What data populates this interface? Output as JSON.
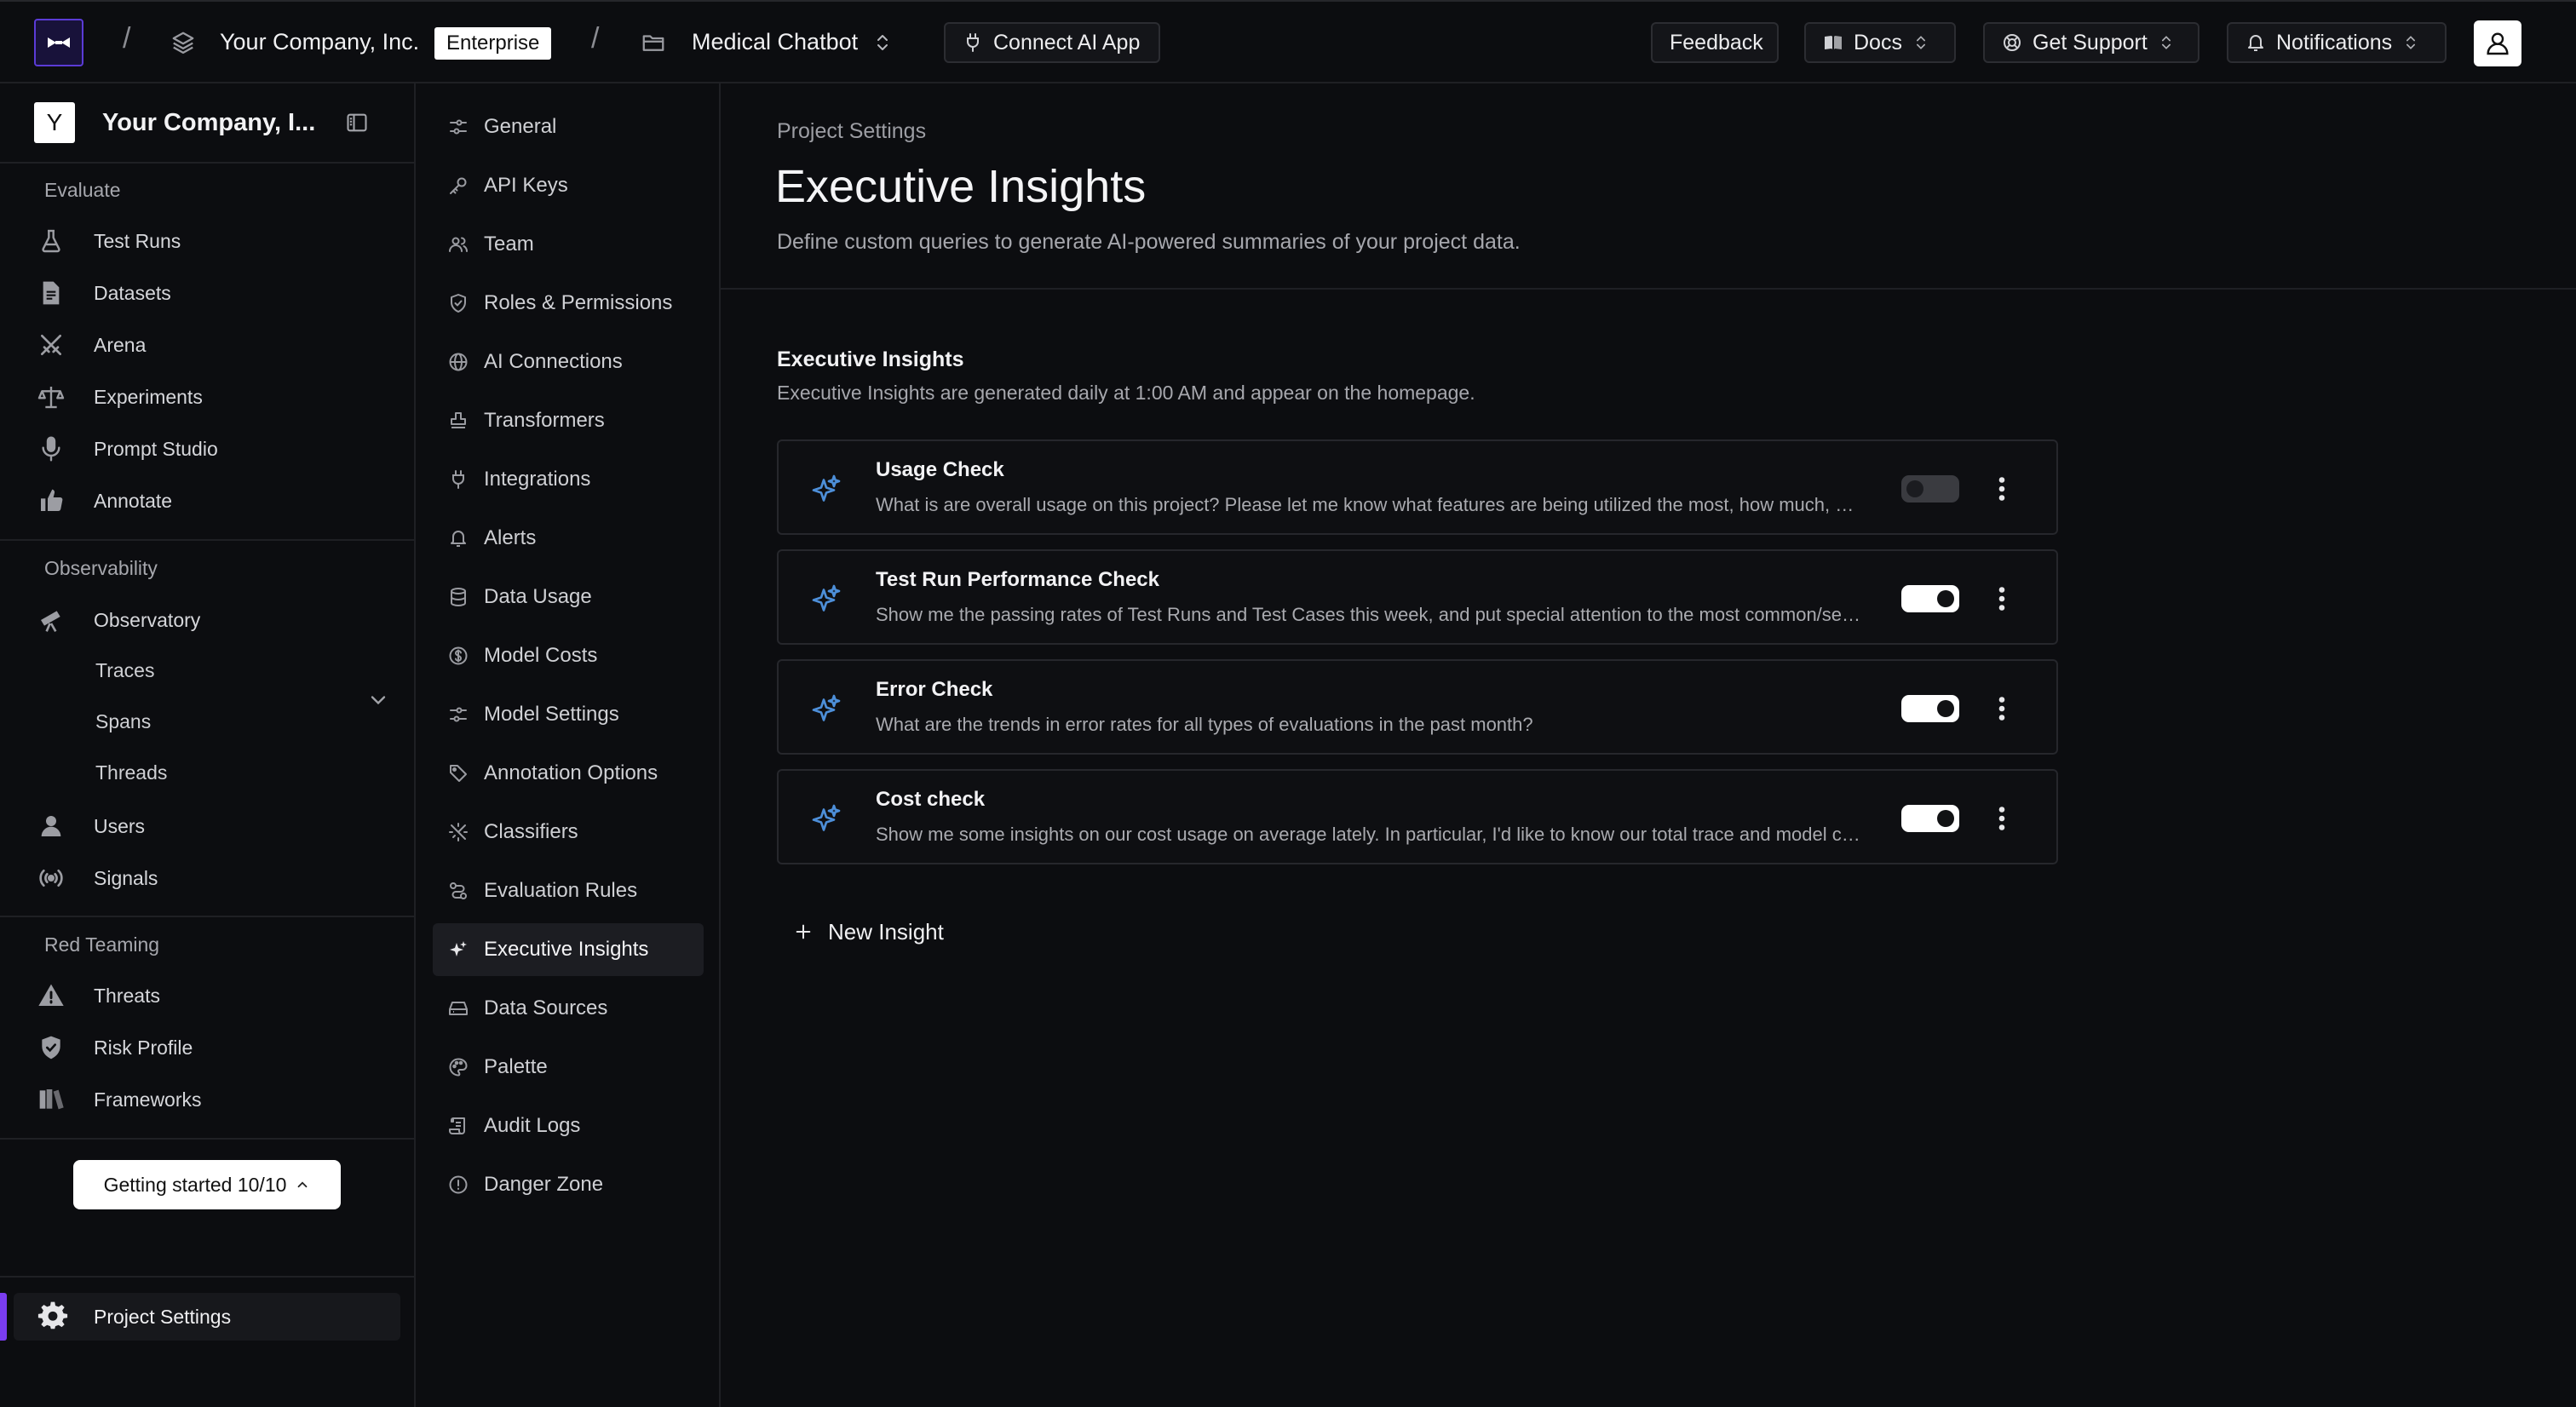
{
  "topbar": {
    "org_name": "Your Company, Inc.",
    "plan_badge": "Enterprise",
    "project_name": "Medical Chatbot",
    "connect_label": "Connect AI App",
    "feedback_label": "Feedback",
    "docs_label": "Docs",
    "support_label": "Get Support",
    "notifications_label": "Notifications",
    "separator": "/"
  },
  "sidebar": {
    "org_initial": "Y",
    "org_name": "Your Company, I...",
    "sections": [
      {
        "title": "Evaluate",
        "items": [
          {
            "label": "Test Runs",
            "icon": "flask-icon"
          },
          {
            "label": "Datasets",
            "icon": "document-icon"
          },
          {
            "label": "Arena",
            "icon": "swords-icon"
          },
          {
            "label": "Experiments",
            "icon": "scale-icon"
          },
          {
            "label": "Prompt Studio",
            "icon": "microphone-icon"
          },
          {
            "label": "Annotate",
            "icon": "thumbs-up-icon"
          }
        ]
      },
      {
        "title": "Observability",
        "items": [
          {
            "label": "Observatory",
            "icon": "telescope-icon"
          },
          {
            "label": "Traces"
          },
          {
            "label": "Spans"
          },
          {
            "label": "Threads"
          },
          {
            "label": "Users",
            "icon": "user-icon"
          },
          {
            "label": "Signals",
            "icon": "signal-icon"
          }
        ]
      },
      {
        "title": "Red Teaming",
        "items": [
          {
            "label": "Threats",
            "icon": "warning-icon"
          },
          {
            "label": "Risk Profile",
            "icon": "shield-icon"
          },
          {
            "label": "Frameworks",
            "icon": "book-icon"
          }
        ]
      }
    ],
    "getting_started": "Getting started 10/10",
    "project_settings": "Project Settings"
  },
  "settings_nav": {
    "active": "Executive Insights",
    "items": [
      {
        "label": "General",
        "icon": "sliders-icon"
      },
      {
        "label": "API Keys",
        "icon": "key-icon"
      },
      {
        "label": "Team",
        "icon": "users-icon"
      },
      {
        "label": "Roles & Permissions",
        "icon": "shield-check-icon"
      },
      {
        "label": "AI Connections",
        "icon": "globe-icon"
      },
      {
        "label": "Transformers",
        "icon": "stamp-icon"
      },
      {
        "label": "Integrations",
        "icon": "plug-icon"
      },
      {
        "label": "Alerts",
        "icon": "bell-icon"
      },
      {
        "label": "Data Usage",
        "icon": "database-icon"
      },
      {
        "label": "Model Costs",
        "icon": "dollar-circle-icon"
      },
      {
        "label": "Model Settings",
        "icon": "sliders-icon"
      },
      {
        "label": "Annotation Options",
        "icon": "tag-icon"
      },
      {
        "label": "Classifiers",
        "icon": "sparkle-grid-icon"
      },
      {
        "label": "Evaluation Rules",
        "icon": "route-icon"
      },
      {
        "label": "Executive Insights",
        "icon": "sparkles-icon"
      },
      {
        "label": "Data Sources",
        "icon": "hard-drive-icon"
      },
      {
        "label": "Palette",
        "icon": "palette-icon"
      },
      {
        "label": "Audit Logs",
        "icon": "scroll-icon"
      },
      {
        "label": "Danger Zone",
        "icon": "alert-circle-icon"
      }
    ]
  },
  "main": {
    "eyebrow": "Project Settings",
    "title": "Executive Insights",
    "description": "Define custom queries to generate AI-powered summaries of your project data.",
    "section_title": "Executive Insights",
    "section_description": "Executive Insights are generated daily at 1:00 AM and appear on the homepage.",
    "insights": [
      {
        "title": "Usage Check",
        "query": "What is are overall usage on this project? Please let me know what features are being utilized the most, how much, and which ones could use more attention.",
        "enabled": false
      },
      {
        "title": "Test Run Performance Check",
        "query": "Show me the passing rates of Test Runs and Test Cases this week, and put special attention to the most common/severe failures.",
        "enabled": true
      },
      {
        "title": "Error Check",
        "query": "What are the trends in error rates for all types of evaluations in the past month?",
        "enabled": true
      },
      {
        "title": "Cost check",
        "query": "Show me some insights on our cost usage on average lately. In particular, I'd like to know our total trace and model costs.",
        "enabled": true
      }
    ],
    "new_insight_label": "New Insight"
  },
  "colors": {
    "background": "#0c0d10",
    "accent": "#7b3df0",
    "sparkle": "#4d8fd9"
  }
}
